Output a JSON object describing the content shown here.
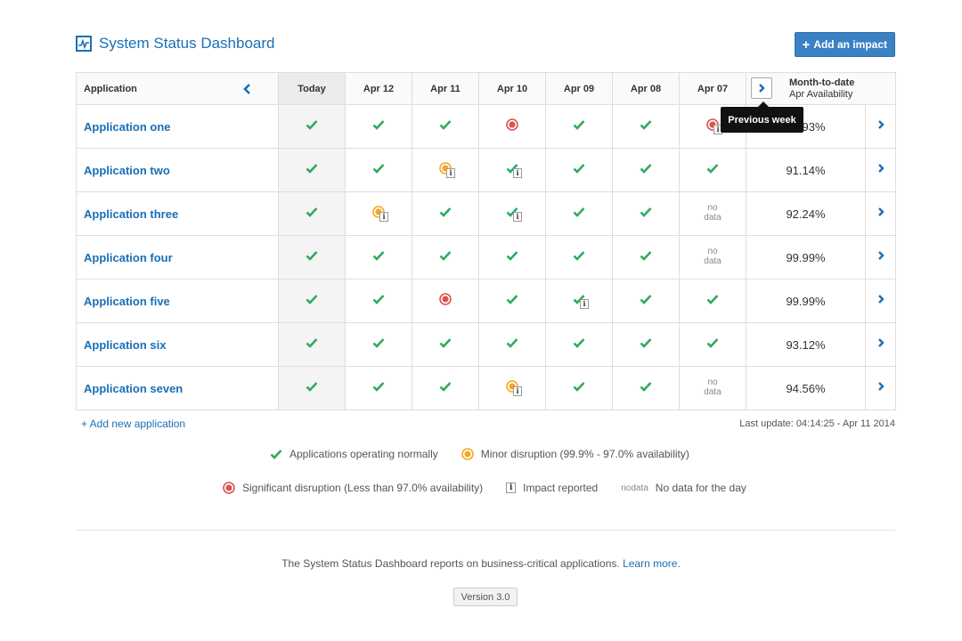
{
  "header": {
    "title": "System Status Dashboard",
    "add_impact_label": "Add an impact",
    "add_impact_icon": "plus-icon"
  },
  "table": {
    "app_header": "Application",
    "columns": [
      "Today",
      "Apr 12",
      "Apr 11",
      "Apr 10",
      "Apr 09",
      "Apr 08",
      "Apr 07"
    ],
    "mtd_header": "Month-to-date",
    "mtd_sub": "Apr Availability",
    "prev_icon": "chevron-left-icon",
    "next_icon": "chevron-right-icon",
    "tooltip": "Previous week",
    "rows": [
      {
        "name": "Application one",
        "mtd": "99.93%",
        "cells": [
          {
            "s": "ok"
          },
          {
            "s": "ok"
          },
          {
            "s": "ok"
          },
          {
            "s": "major"
          },
          {
            "s": "ok"
          },
          {
            "s": "ok"
          },
          {
            "s": "major",
            "i": true
          }
        ]
      },
      {
        "name": "Application two",
        "mtd": "91.14%",
        "cells": [
          {
            "s": "ok"
          },
          {
            "s": "ok"
          },
          {
            "s": "minor",
            "i": true
          },
          {
            "s": "ok",
            "i": true
          },
          {
            "s": "ok"
          },
          {
            "s": "ok"
          },
          {
            "s": "ok"
          }
        ]
      },
      {
        "name": "Application three",
        "mtd": "92.24%",
        "cells": [
          {
            "s": "ok"
          },
          {
            "s": "minor",
            "i": true
          },
          {
            "s": "ok"
          },
          {
            "s": "ok",
            "i": true
          },
          {
            "s": "ok"
          },
          {
            "s": "ok"
          },
          {
            "s": "nodata"
          }
        ]
      },
      {
        "name": "Application four",
        "mtd": "99.99%",
        "cells": [
          {
            "s": "ok"
          },
          {
            "s": "ok"
          },
          {
            "s": "ok"
          },
          {
            "s": "ok"
          },
          {
            "s": "ok"
          },
          {
            "s": "ok"
          },
          {
            "s": "nodata"
          }
        ]
      },
      {
        "name": "Application five",
        "mtd": "99.99%",
        "cells": [
          {
            "s": "ok"
          },
          {
            "s": "ok"
          },
          {
            "s": "major"
          },
          {
            "s": "ok"
          },
          {
            "s": "ok",
            "i": true
          },
          {
            "s": "ok"
          },
          {
            "s": "ok"
          }
        ]
      },
      {
        "name": "Application six",
        "mtd": "93.12%",
        "cells": [
          {
            "s": "ok"
          },
          {
            "s": "ok"
          },
          {
            "s": "ok"
          },
          {
            "s": "ok"
          },
          {
            "s": "ok"
          },
          {
            "s": "ok"
          },
          {
            "s": "ok"
          }
        ]
      },
      {
        "name": "Application seven",
        "mtd": "94.56%",
        "cells": [
          {
            "s": "ok"
          },
          {
            "s": "ok"
          },
          {
            "s": "ok"
          },
          {
            "s": "minor",
            "i": true
          },
          {
            "s": "ok"
          },
          {
            "s": "ok"
          },
          {
            "s": "nodata"
          }
        ]
      }
    ],
    "nodata_line1": "no",
    "nodata_line2": "data",
    "info_glyph": "i"
  },
  "add_app_label": "+ Add new application",
  "last_update": "Last update: 04:14:25 - Apr 11 2014",
  "legend": {
    "ok": "Applications operating normally",
    "minor": "Minor disruption (99.9% - 97.0% availability)",
    "major": "Significant disruption (Less than 97.0% availability)",
    "impact": "Impact reported",
    "nodata": "No data for the day"
  },
  "footer": {
    "text": "The System Status Dashboard reports on business-critical applications.",
    "learn_more": "Learn more.",
    "version": "Version 3.0"
  },
  "colors": {
    "ok": "#2eab5f",
    "minor": "#f5a623",
    "major": "#d9534f",
    "link": "#1a6fb5",
    "button": "#3b82c4"
  }
}
